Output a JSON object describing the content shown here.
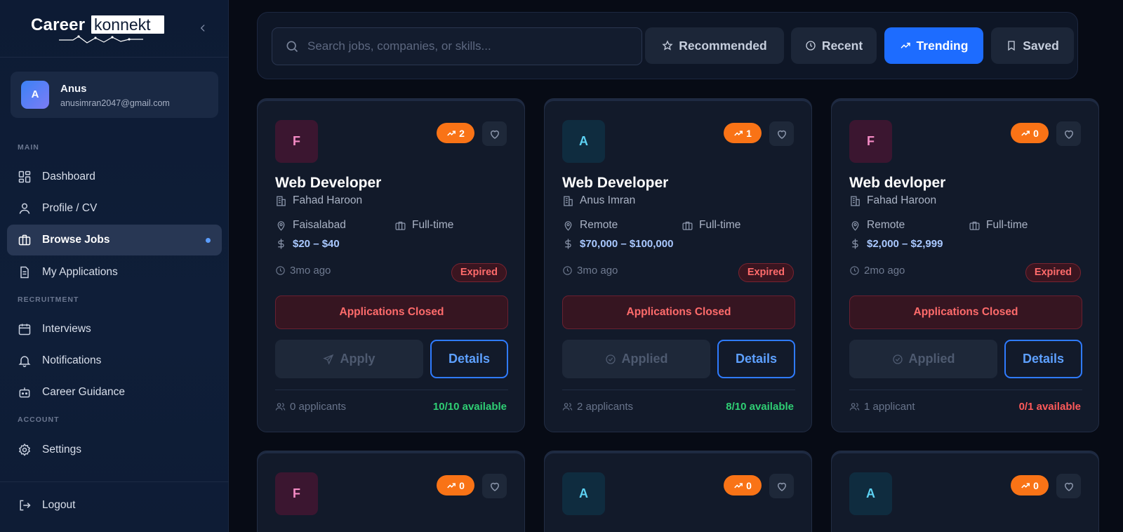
{
  "brand": {
    "logo_part1": "Career",
    "logo_part2": "konnekt"
  },
  "user": {
    "initial": "A",
    "name": "Anus",
    "email": "anusimran2047@gmail.com"
  },
  "sidebar": {
    "sections": {
      "main": "MAIN",
      "recruitment": "RECRUITMENT",
      "account": "ACCOUNT"
    },
    "items": [
      {
        "label": "Dashboard",
        "icon": "dashboard-icon"
      },
      {
        "label": "Profile / CV",
        "icon": "user-icon"
      },
      {
        "label": "Browse Jobs",
        "icon": "briefcase-icon",
        "active": true
      },
      {
        "label": "My Applications",
        "icon": "document-icon"
      },
      {
        "label": "Interviews",
        "icon": "calendar-icon"
      },
      {
        "label": "Notifications",
        "icon": "bell-icon"
      },
      {
        "label": "Career Guidance",
        "icon": "robot-icon"
      },
      {
        "label": "Settings",
        "icon": "gear-icon"
      }
    ],
    "logout": "Logout"
  },
  "search": {
    "placeholder": "Search jobs, companies, or skills..."
  },
  "tabs": [
    {
      "label": "Recommended",
      "icon": "star-icon"
    },
    {
      "label": "Recent",
      "icon": "clock-icon"
    },
    {
      "label": "Trending",
      "icon": "trending-icon",
      "active": true
    },
    {
      "label": "Saved",
      "icon": "bookmark-icon"
    }
  ],
  "colors": {
    "accent": "#1d6cff",
    "trend": "#f97316",
    "expired": "#ff6b6b",
    "available": "#2fcf74"
  },
  "jobs": [
    {
      "initial": "F",
      "trend": "2",
      "title": "Web Developer",
      "company": "Fahad Haroon",
      "location": "Faisalabad",
      "type": "Full-time",
      "salary": "$20 – $40",
      "posted": "3mo ago",
      "status": "Expired",
      "closed": "Applications Closed",
      "action": "Apply",
      "details": "Details",
      "applicants": "0 applicants",
      "availability": "10/10 available"
    },
    {
      "initial": "A",
      "trend": "1",
      "title": "Web Developer",
      "company": "Anus Imran",
      "location": "Remote",
      "type": "Full-time",
      "salary": "$70,000 – $100,000",
      "posted": "3mo ago",
      "status": "Expired",
      "closed": "Applications Closed",
      "action": "Applied",
      "details": "Details",
      "applicants": "2 applicants",
      "availability": "8/10 available"
    },
    {
      "initial": "F",
      "trend": "0",
      "title": "Web devloper",
      "company": "Fahad Haroon",
      "location": "Remote",
      "type": "Full-time",
      "salary": "$2,000 – $2,999",
      "posted": "2mo ago",
      "status": "Expired",
      "closed": "Applications Closed",
      "action": "Applied",
      "details": "Details",
      "applicants": "1 applicant",
      "availability": "0/1 available"
    },
    {
      "initial": "F",
      "trend": "0"
    },
    {
      "initial": "A",
      "trend": "0"
    },
    {
      "initial": "A",
      "trend": "0"
    }
  ]
}
